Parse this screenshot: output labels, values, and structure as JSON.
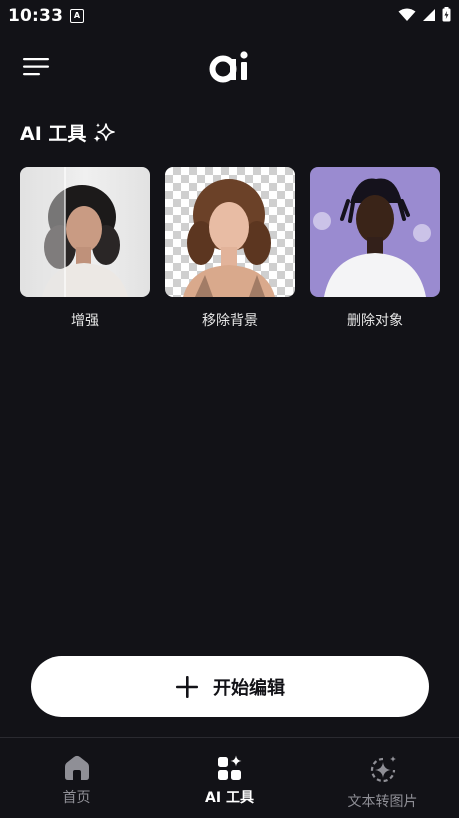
{
  "status_bar": {
    "time": "10:33",
    "app_icon_letter": "A"
  },
  "header": {
    "menu_icon": "hamburger-menu-icon",
    "logo": "ai-logo"
  },
  "section": {
    "title": "AI 工具",
    "icon": "sparkle-icon"
  },
  "tools": [
    {
      "label": "增强"
    },
    {
      "label": "移除背景"
    },
    {
      "label": "删除对象"
    }
  ],
  "start_button": {
    "label": "开始编辑",
    "icon": "plus-icon"
  },
  "bottom_nav": {
    "items": [
      {
        "label": "首页",
        "icon": "home-icon",
        "active": false
      },
      {
        "label": "AI 工具",
        "icon": "ai-tools-icon",
        "active": true
      },
      {
        "label": "文本转图片",
        "icon": "text-to-image-icon",
        "active": false
      }
    ]
  },
  "colors": {
    "background": "#121217",
    "primary_button": "#ffffff",
    "inactive_nav": "#8f8f96"
  }
}
